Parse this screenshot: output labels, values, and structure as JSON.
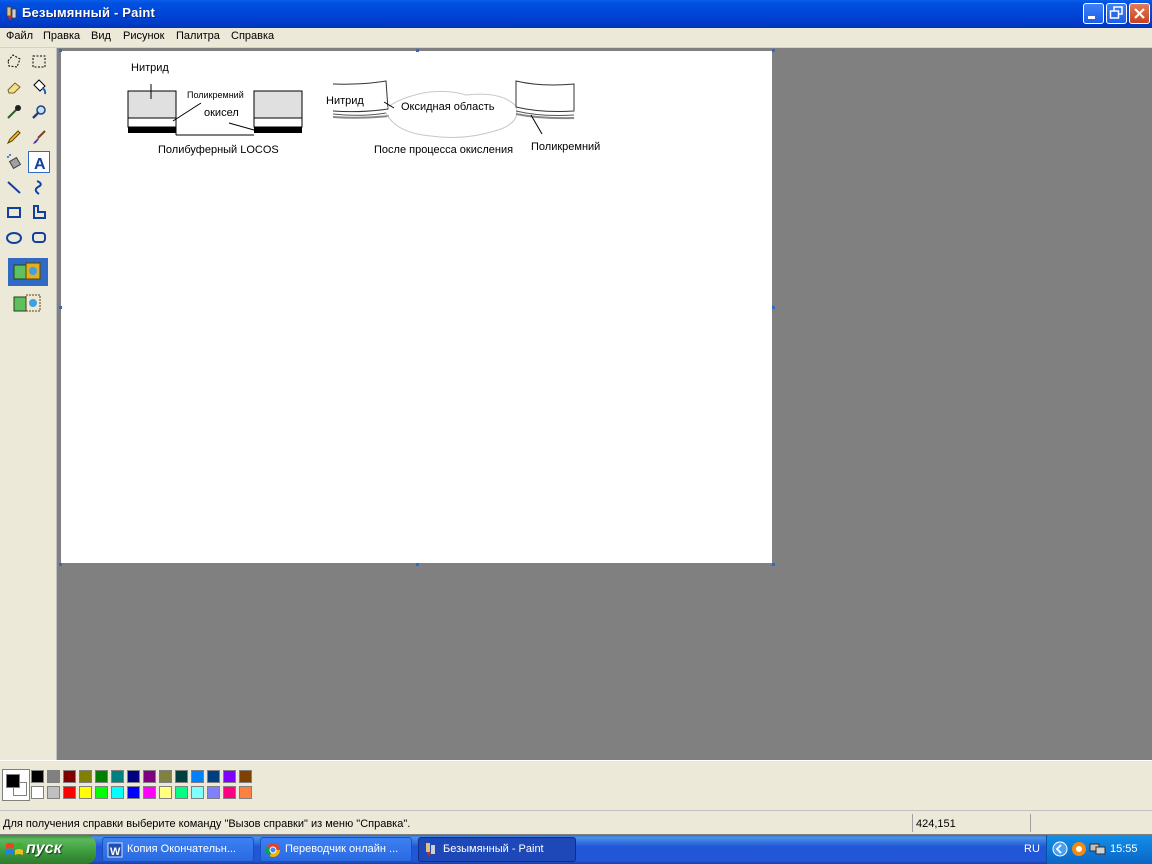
{
  "window": {
    "title": "Безымянный - Paint"
  },
  "menu": [
    "Файл",
    "Правка",
    "Вид",
    "Рисунок",
    "Палитра",
    "Справка"
  ],
  "tools": [
    {
      "name": "free-select-icon"
    },
    {
      "name": "rect-select-icon"
    },
    {
      "name": "eraser-icon"
    },
    {
      "name": "fill-icon"
    },
    {
      "name": "color-picker-icon"
    },
    {
      "name": "magnifier-icon"
    },
    {
      "name": "pencil-icon"
    },
    {
      "name": "brush-icon"
    },
    {
      "name": "airbrush-icon"
    },
    {
      "name": "text-icon",
      "active": true
    },
    {
      "name": "line-icon"
    },
    {
      "name": "curve-icon"
    },
    {
      "name": "rectangle-icon"
    },
    {
      "name": "polygon-icon"
    },
    {
      "name": "ellipse-icon"
    },
    {
      "name": "rounded-rect-icon"
    }
  ],
  "drawing": {
    "left": {
      "label_top": "Нитрид",
      "label_poly": "Поликремний",
      "label_oxide": "окисел",
      "caption": "Полибуферный LOCOS"
    },
    "right": {
      "label_nitride": "Нитрид",
      "label_oxide": "Оксидная область",
      "label_poly": "Поликремний",
      "caption": "После процесса окисления"
    }
  },
  "palette": {
    "foreground": "#000000",
    "background": "#ffffff",
    "row1": [
      "#000000",
      "#808080",
      "#800000",
      "#808000",
      "#008000",
      "#008080",
      "#000080",
      "#800080",
      "#808040",
      "#004040",
      "#0080ff",
      "#004080",
      "#8000ff",
      "#804000"
    ],
    "row2": [
      "#ffffff",
      "#c0c0c0",
      "#ff0000",
      "#ffff00",
      "#00ff00",
      "#00ffff",
      "#0000ff",
      "#ff00ff",
      "#ffff80",
      "#00ff80",
      "#80ffff",
      "#8080ff",
      "#ff0080",
      "#ff8040"
    ]
  },
  "status": {
    "help": "Для получения справки выберите команду \"Вызов справки\" из меню \"Справка\".",
    "coords": "424,151"
  },
  "taskbar": {
    "start": "пуск",
    "tasks": [
      {
        "label": "Копия Окончательн..."
      },
      {
        "label": "Переводчик онлайн ..."
      },
      {
        "label": "Безымянный - Paint"
      }
    ],
    "lang": "RU",
    "clock": "15:55"
  }
}
